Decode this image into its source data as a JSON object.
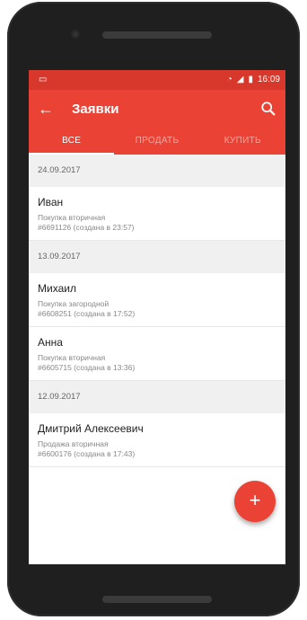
{
  "status_bar": {
    "time": "16:09"
  },
  "app_bar": {
    "title": "Заявки",
    "back_icon": "arrow-left-icon",
    "search_icon": "search-icon"
  },
  "tabs": [
    {
      "label": "ВСЕ",
      "active": true
    },
    {
      "label": "ПРОДАТЬ",
      "active": false
    },
    {
      "label": "КУПИТЬ",
      "active": false
    }
  ],
  "groups": [
    {
      "date": "24.09.2017",
      "items": [
        {
          "name": "Иван",
          "type": "Покупка вторичная",
          "meta": "#6691126 (создана в 23:57)"
        }
      ]
    },
    {
      "date": "13.09.2017",
      "items": [
        {
          "name": "Михаил",
          "type": "Покупка загородной",
          "meta": "#6608251 (создана в 17:52)"
        },
        {
          "name": "Анна",
          "type": "Покупка вторичная",
          "meta": "#6605715 (создана в 13:36)"
        }
      ]
    },
    {
      "date": "12.09.2017",
      "items": [
        {
          "name": "Дмитрий Алексеевич",
          "type": "Продажа вторичная",
          "meta": "#6600176 (создана в 17:43)"
        }
      ]
    }
  ],
  "fab": {
    "label": "+"
  },
  "colors": {
    "primary": "#ea4335",
    "status": "#d8372c"
  }
}
